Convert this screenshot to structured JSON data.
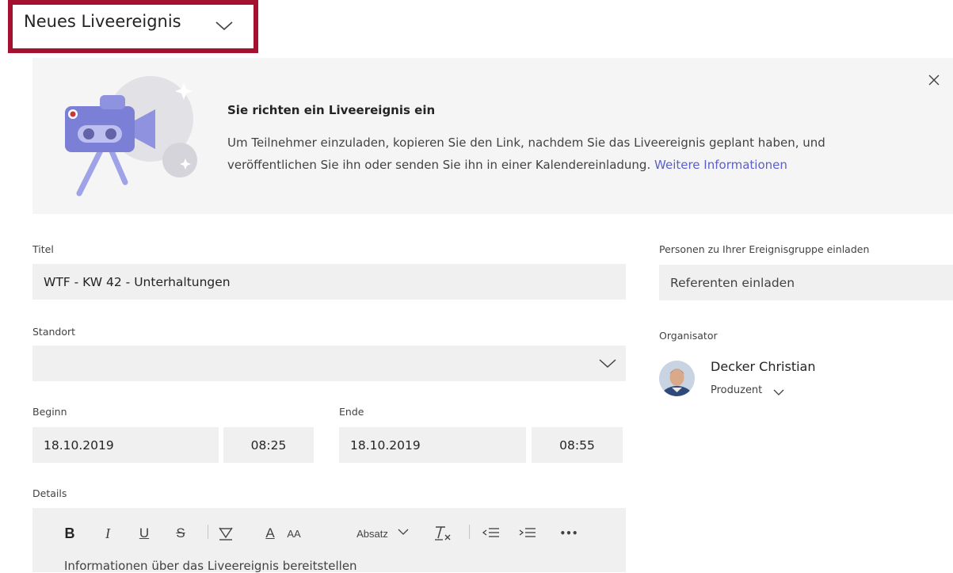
{
  "header": {
    "title": "Neues Liveereignis"
  },
  "banner": {
    "heading": "Sie richten ein Liveereignis ein",
    "line1": "Um Teilnehmer einzuladen, kopieren Sie den Link, nachdem Sie das Liveereignis geplant haben, und",
    "line2": "veröffentlichen Sie ihn oder senden Sie ihn in einer Kalendereinladung.",
    "link": "Weitere Informationen"
  },
  "form": {
    "title_label": "Titel",
    "title_value": "WTF - KW 42 - Unterhaltungen",
    "location_label": "Standort",
    "location_value": "",
    "start_label": "Beginn",
    "start_date": "18.10.2019",
    "start_time": "08:25",
    "end_label": "Ende",
    "end_date": "18.10.2019",
    "end_time": "08:55",
    "details_label": "Details",
    "details_placeholder": "Informationen über das Liveereignis bereitstellen"
  },
  "people": {
    "invite_label": "Personen zu Ihrer Ereignisgruppe einladen",
    "invite_placeholder": "Referenten einladen",
    "organizer_label": "Organisator",
    "organizer_name": "Decker Christian",
    "organizer_role": "Produzent"
  },
  "toolbar": {
    "bold": "B",
    "italic": "I",
    "underline": "U",
    "strike": "S",
    "font_color": "A",
    "font_size": "AA",
    "paragraph": "Absatz",
    "more": "•••"
  },
  "colors": {
    "highlight": "#a4122f",
    "link": "#5b5fc7",
    "banner_bg": "#f5f5f5",
    "field_bg": "#f0f0f0"
  }
}
